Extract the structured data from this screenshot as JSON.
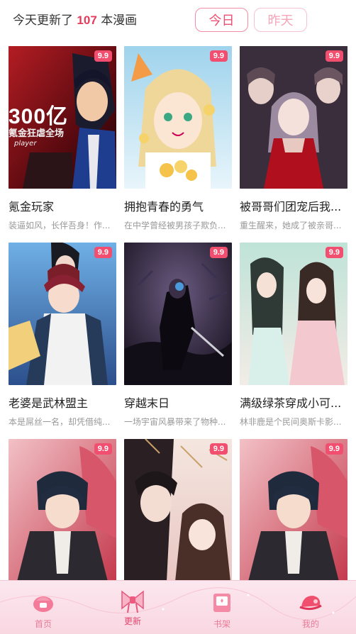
{
  "header": {
    "prefix": "今天更新了",
    "count": "107",
    "suffix": "本漫画",
    "tabs": [
      {
        "label": "今日",
        "active": true
      },
      {
        "label": "昨天",
        "active": false
      }
    ]
  },
  "comics": [
    {
      "title": "氪金玩家",
      "desc": "装逼如风，长伴吾身！作...",
      "badge": "9.9",
      "cover_text": "300亿",
      "cover_sub": "氪金狂虐全场",
      "cover_en": "player"
    },
    {
      "title": "拥抱青春的勇气",
      "desc": "在中学曾经被男孩子欺负...",
      "badge": "9.9"
    },
    {
      "title": "被哥哥们团宠后我...",
      "desc": "重生醒来，她成了被亲哥...",
      "badge": "9.9"
    },
    {
      "title": "老婆是武林盟主",
      "desc": "本是屌丝一名，却凭借纯...",
      "badge": "9.9"
    },
    {
      "title": "穿越末日",
      "desc": "一场宇宙风暴带来了物种...",
      "badge": "9.9"
    },
    {
      "title": "满级绿茶穿成小可...",
      "desc": "林非鹿是个民间奥斯卡影...",
      "badge": "9.9"
    },
    {
      "title": "",
      "desc": "",
      "badge": "9.9"
    },
    {
      "title": "",
      "desc": "",
      "badge": "9.9"
    },
    {
      "title": "",
      "desc": "",
      "badge": "9.9"
    }
  ],
  "tabbar": {
    "items": [
      {
        "label": "首页",
        "icon": "home-icon",
        "active": false
      },
      {
        "label": "更新",
        "icon": "update-bow-icon",
        "active": true
      },
      {
        "label": "书架",
        "icon": "bookshelf-icon",
        "active": false
      },
      {
        "label": "我的",
        "icon": "profile-hat-icon",
        "active": false
      }
    ]
  }
}
